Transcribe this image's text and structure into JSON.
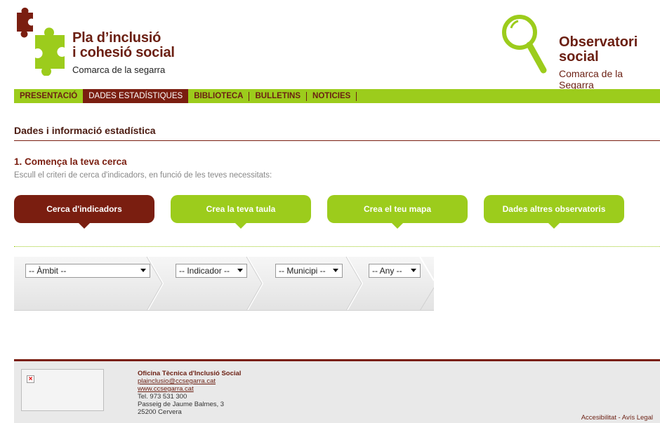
{
  "brand": {
    "title_line1": "Pla d’inclusió",
    "title_line2": "i cohesió social",
    "subtitle": "Comarca de la segarra"
  },
  "observatori": {
    "title_line1": "Observatori",
    "title_line2": "social",
    "subtitle": "Comarca de la Segarra"
  },
  "nav": {
    "items": [
      "PRESENTACIÓ",
      "DADES ESTADÍSTIQUES",
      "BIBLIOTECA",
      "BULLETINS",
      "NOTICIES"
    ],
    "active_index": 1
  },
  "page": {
    "title": "Dades i informació estadística",
    "step_title": "1. Comença la teva cerca",
    "step_hint": "Escull el criteri de cerca d'indicadors, en funció de les teves necessitats:"
  },
  "tabs": {
    "items": [
      "Cerca d'indicadors",
      "Crea la teva taula",
      "Crea el teu mapa",
      "Dades altres observatoris"
    ],
    "active_index": 0
  },
  "filters": {
    "ambit": "-- Àmbit --",
    "indicador": "-- Indicador --",
    "municipi": "-- Municipi --",
    "any": "-- Any --"
  },
  "footer": {
    "org": "Oficina Tècnica d'Inclusió Social",
    "email": "plainclusio@ccsegarra.cat",
    "web": "www.ccsegarra.cat",
    "tel": "Tel. 973 531 300",
    "address1": "Passeig de Jaume Balmes, 3",
    "address2": "25200 Cervera",
    "accessibility": "Accesibilitat",
    "legal_sep": " - ",
    "legal": "Avís Legal"
  },
  "colors": {
    "brand_green": "#9ccc1c",
    "brand_maroon": "#7a1e10"
  }
}
